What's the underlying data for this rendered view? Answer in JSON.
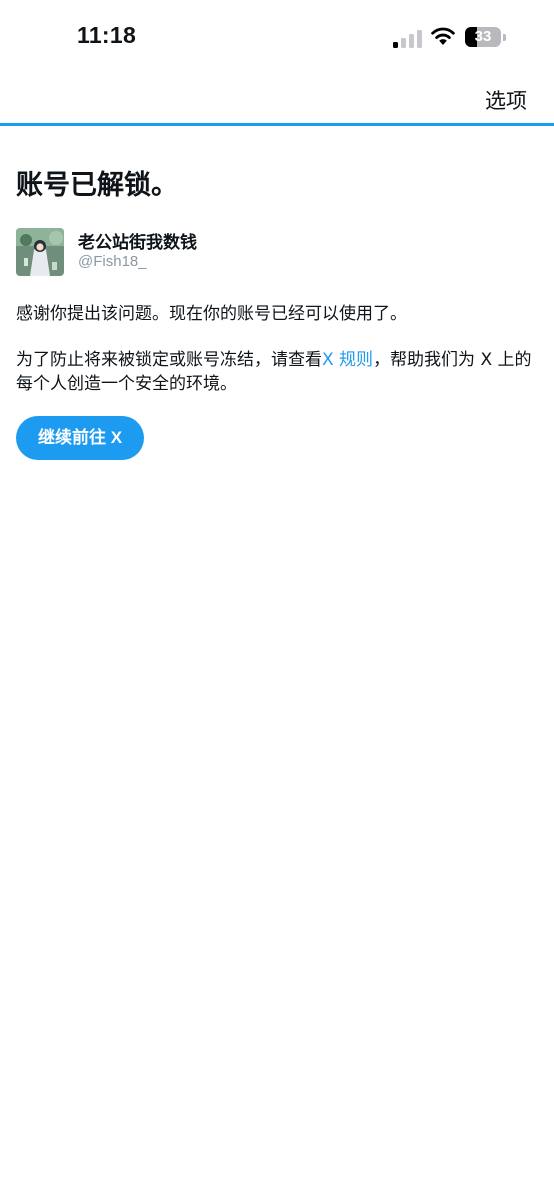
{
  "status_bar": {
    "time": "11:18",
    "battery": "33",
    "battery_level": 0.33
  },
  "nav": {
    "options_label": "选项"
  },
  "accent_color": "#1d9bf0",
  "main": {
    "title": "账号已解锁。",
    "user": {
      "display_name": "老公站街我数钱",
      "handle": "@Fish18_"
    },
    "paragraph1": "感谢你提出该问题。现在你的账号已经可以使用了。",
    "paragraph2_before": "为了防止将来被锁定或账号冻结，请查看",
    "paragraph2_link": "X 规则",
    "paragraph2_after": "，帮助我们为 X 上的每个人创造一个安全的环境。",
    "continue_button": "继续前往 X"
  },
  "icons": {
    "signal": "cellular-signal-icon",
    "wifi": "wifi-icon",
    "battery": "battery-icon"
  }
}
